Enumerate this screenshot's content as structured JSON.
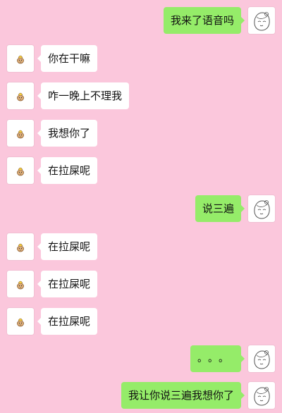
{
  "colors": {
    "background": "#fbc7dc",
    "incoming_bubble": "#ffffff",
    "outgoing_bubble": "#95ec69"
  },
  "messages": [
    {
      "direction": "out",
      "text": "我来了语音吗",
      "avatar_icon": "girl-sketch-avatar-icon"
    },
    {
      "direction": "in",
      "text": "你在干嘛",
      "avatar_icon": "cartoon-avatar-icon"
    },
    {
      "direction": "in",
      "text": "咋一晚上不理我",
      "avatar_icon": "cartoon-avatar-icon"
    },
    {
      "direction": "in",
      "text": "我想你了",
      "avatar_icon": "cartoon-avatar-icon"
    },
    {
      "direction": "in",
      "text": "在拉屎呢",
      "avatar_icon": "cartoon-avatar-icon"
    },
    {
      "direction": "out",
      "text": "说三遍",
      "avatar_icon": "girl-sketch-avatar-icon"
    },
    {
      "direction": "in",
      "text": "在拉屎呢",
      "avatar_icon": "cartoon-avatar-icon"
    },
    {
      "direction": "in",
      "text": "在拉屎呢",
      "avatar_icon": "cartoon-avatar-icon"
    },
    {
      "direction": "in",
      "text": "在拉屎呢",
      "avatar_icon": "cartoon-avatar-icon"
    },
    {
      "direction": "out",
      "text": "。。。",
      "avatar_icon": "girl-sketch-avatar-icon"
    },
    {
      "direction": "out",
      "text": "我让你说三遍我想你了",
      "avatar_icon": "girl-sketch-avatar-icon"
    }
  ]
}
